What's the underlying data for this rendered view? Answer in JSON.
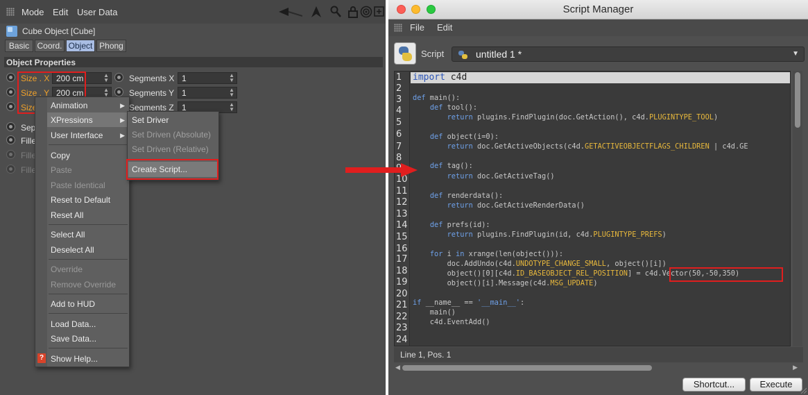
{
  "attribute_manager": {
    "menu": [
      "Mode",
      "Edit",
      "User Data"
    ],
    "object_title": "Cube Object [Cube]",
    "tabs": [
      "Basic",
      "Coord.",
      "Object",
      "Phong"
    ],
    "active_tab": "Object",
    "section": "Object Properties",
    "params": {
      "size_x_label": "Size . X",
      "size_x_value": "200 cm",
      "size_y_label": "Size . Y",
      "size_y_value": "200 cm",
      "size_z_label": "Size",
      "seg_x_label": "Segments X",
      "seg_x_value": "1",
      "seg_y_label": "Segments Y",
      "seg_y_value": "1",
      "seg_z_label": "Segments Z",
      "seg_z_value": "1",
      "sep_label": "Sep",
      "fill1_label": "Fille",
      "fill2_label": "Fille",
      "fill3_label": "Fille"
    },
    "icons": [
      "grid-grip-icon",
      "arrow-back-icon",
      "cursor-up-icon",
      "search-icon",
      "lock-icon",
      "target-icon",
      "add-panel-icon"
    ]
  },
  "context_menu": {
    "items": [
      {
        "label": "Animation",
        "submenu": true
      },
      {
        "label": "XPressions",
        "submenu": true
      },
      {
        "label": "User Interface",
        "submenu": true
      },
      {
        "label": "Copy"
      },
      {
        "label": "Paste",
        "disabled": true
      },
      {
        "label": "Paste Identical",
        "disabled": true
      },
      {
        "label": "Reset to Default"
      },
      {
        "label": "Reset All"
      },
      {
        "label": "Select All"
      },
      {
        "label": "Deselect All"
      },
      {
        "label": "Override",
        "disabled": true
      },
      {
        "label": "Remove Override",
        "disabled": true
      },
      {
        "label": "Add to HUD"
      },
      {
        "label": "Load Data..."
      },
      {
        "label": "Save Data..."
      },
      {
        "label": "Show Help..."
      }
    ]
  },
  "xpressions_submenu": {
    "items": [
      {
        "label": "Set Driver"
      },
      {
        "label": "Set Driven (Absolute)",
        "disabled": true
      },
      {
        "label": "Set Driven (Relative)",
        "disabled": true
      },
      {
        "label": "Create Script..."
      }
    ]
  },
  "script_manager": {
    "window_title": "Script Manager",
    "menu": [
      "File",
      "Edit"
    ],
    "script_label": "Script",
    "script_name": "untitled 1 *",
    "line_numbers": [
      "1",
      "2",
      "3",
      "4",
      "5",
      "6",
      "7",
      "8",
      "9",
      "10",
      "11",
      "12",
      "13",
      "14",
      "15",
      "16",
      "17",
      "18",
      "19",
      "20",
      "21",
      "22",
      "23",
      "24"
    ],
    "code_lines": [
      "import c4d",
      "",
      "def main():",
      "    def tool():",
      "        return plugins.FindPlugin(doc.GetAction(), c4d.PLUGINTYPE_TOOL)",
      "",
      "    def object(i=0):",
      "        return doc.GetActiveObjects(c4d.GETACTIVEOBJECTFLAGS_CHILDREN | c4d.GE",
      "",
      "    def tag():",
      "        return doc.GetActiveTag()",
      "",
      "    def renderdata():",
      "        return doc.GetActiveRenderData()",
      "",
      "    def prefs(id):",
      "        return plugins.FindPlugin(id, c4d.PLUGINTYPE_PREFS)",
      "",
      "    for i in xrange(len(object())):",
      "        doc.AddUndo(c4d.UNDOTYPE_CHANGE_SMALL, object()[i])",
      "        object()[0][c4d.ID_BASEOBJECT_REL_POSITION] = c4d.Vector(50,-50,350)",
      "        object()[i].Message(c4d.MSG_UPDATE)",
      "",
      "if __name__ == '__main__':",
      "    main()",
      "    c4d.EventAdd()",
      ""
    ],
    "status": "Line 1, Pos. 1",
    "buttons": {
      "shortcut": "Shortcut...",
      "execute": "Execute"
    },
    "colors": {
      "keyword": "#6ea0e8",
      "constant": "#e8b83c",
      "highlight_box": "#e01e1e"
    }
  }
}
